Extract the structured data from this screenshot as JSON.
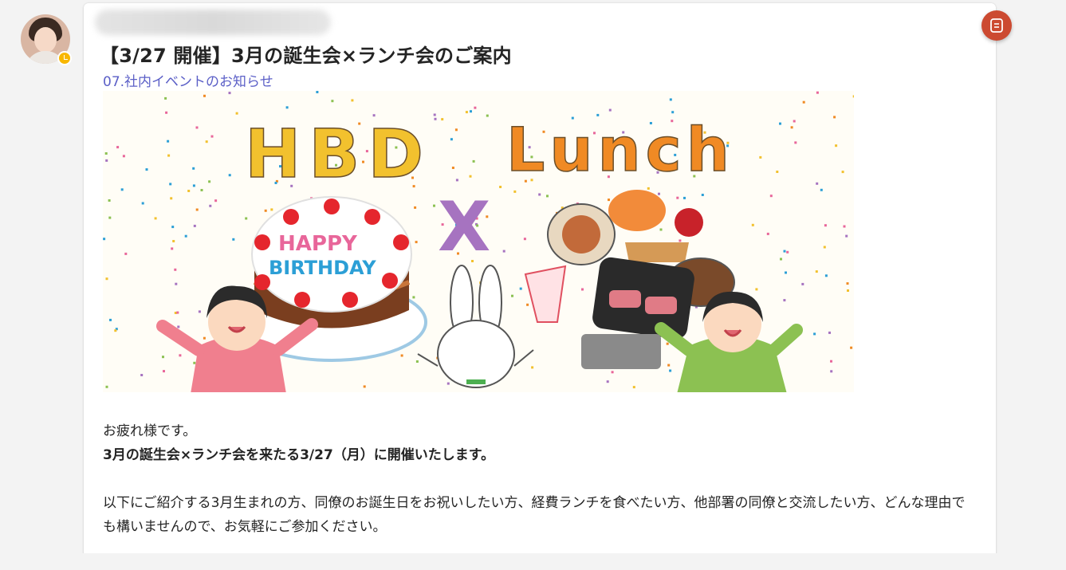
{
  "post": {
    "meta_blurred": "",
    "title": "【3/27 開催】3月の誕生会×ランチ会のご案内",
    "channel": "07.社内イベントのお知らせ",
    "banner": {
      "word_left": "HBD",
      "word_right": "Lunch",
      "cake_line1": "HAPPY",
      "cake_line2": "BIRTHDAY",
      "connector": "X"
    },
    "body": {
      "greeting": "お疲れ様です。",
      "announcement": "3月の誕生会×ランチ会を来たる3/27（月）に開催いたします。",
      "invitation": "以下にご紹介する3月生まれの方、同僚のお誕生日をお祝いしたい方、経費ランチを食べたい方、他部署の同僚と交流したい方、どんな理由でも構いませんので、お気軽にご参加ください。"
    }
  },
  "author": {
    "presence": "away",
    "presence_color": "#f8b700"
  },
  "colors": {
    "accent": "#5b5fc7",
    "action_button": "#cc4a31"
  },
  "icons": {
    "action": "notes-icon"
  }
}
